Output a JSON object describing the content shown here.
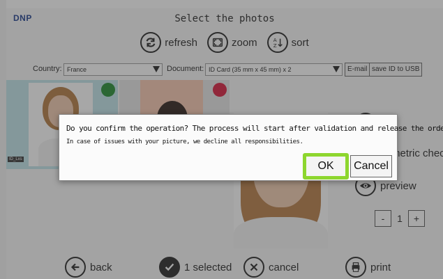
{
  "app": {
    "logo": "DNP",
    "title": "Select the photos"
  },
  "toolbar": {
    "refresh_label": "refresh",
    "zoom_label": "zoom",
    "sort_label": "sort"
  },
  "filters": {
    "country_label": "Country:",
    "country_value": "France",
    "document_label": "Document:",
    "document_value": "ID Card (35 mm x 45 mm) x 2",
    "email_label": "E-mail",
    "save_usb_label": "save ID to USB"
  },
  "thumbnails": [
    {
      "badge": "ID_Lxs",
      "status_color": "#1e8a2e"
    },
    {
      "badge": "",
      "status_color": "#d8173a"
    }
  ],
  "side": {
    "biometric_label": "metric check",
    "preview_label": "preview",
    "quantity": "1",
    "minus_label": "-",
    "plus_label": "+"
  },
  "bottom": {
    "back_label": "back",
    "selected_label": "1 selected",
    "cancel_label": "cancel",
    "print_label": "print"
  },
  "dialog": {
    "message": "Do you confirm the operation? The process will start after validation and release the order.",
    "sub_message": "In case of issues with your picture, we decline all responsibilities.",
    "ok_label": "OK",
    "cancel_label": "Cancel"
  },
  "colors": {
    "highlight": "#8dd62e",
    "logo": "#1a3b8c"
  }
}
